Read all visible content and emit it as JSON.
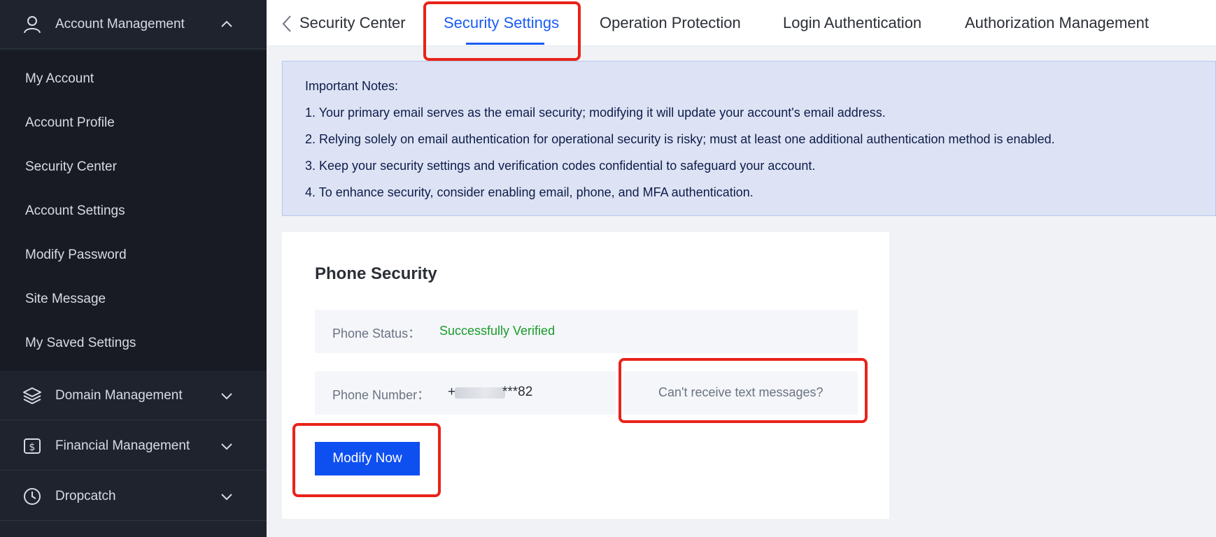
{
  "sidebar": {
    "groups": [
      {
        "label": "Account Management",
        "icon": "user-icon",
        "expanded": true
      },
      {
        "label": "Domain Management",
        "icon": "layers-icon",
        "expanded": false
      },
      {
        "label": "Financial Management",
        "icon": "dollar-icon",
        "expanded": false
      },
      {
        "label": "Dropcatch",
        "icon": "clock-icon",
        "expanded": false
      }
    ],
    "items": [
      {
        "label": "My Account"
      },
      {
        "label": "Account Profile"
      },
      {
        "label": "Security Center"
      },
      {
        "label": "Account Settings"
      },
      {
        "label": "Modify Password"
      },
      {
        "label": "Site Message"
      },
      {
        "label": "My Saved Settings"
      }
    ]
  },
  "tabs": [
    {
      "label": "Security Center"
    },
    {
      "label": "Security Settings",
      "active": true
    },
    {
      "label": "Operation Protection"
    },
    {
      "label": "Login Authentication"
    },
    {
      "label": "Authorization Management"
    }
  ],
  "notice": {
    "title": "Important Notes:",
    "lines": [
      "1. Your primary email serves as the email security; modifying it will update your account's email address.",
      "2. Relying solely on email authentication for operational security is risky; must at least one additional authentication method is enabled.",
      "3. Keep your security settings and verification codes confidential to safeguard your account.",
      "4. To enhance security, consider enabling email, phone, and MFA authentication."
    ]
  },
  "phone_security": {
    "title": "Phone Security",
    "status_label": "Phone Status：",
    "status_value": "Successfully Verified",
    "number_label": "Phone Number：",
    "number_prefix": "+",
    "number_suffix": "***82",
    "cant_receive": "Can't receive text messages?",
    "modify_button": "Modify Now"
  },
  "colors": {
    "accent": "#1a5cf5",
    "success": "#1a9b2a",
    "highlight": "#e8231a",
    "sidebar_bg": "#1f232e"
  }
}
